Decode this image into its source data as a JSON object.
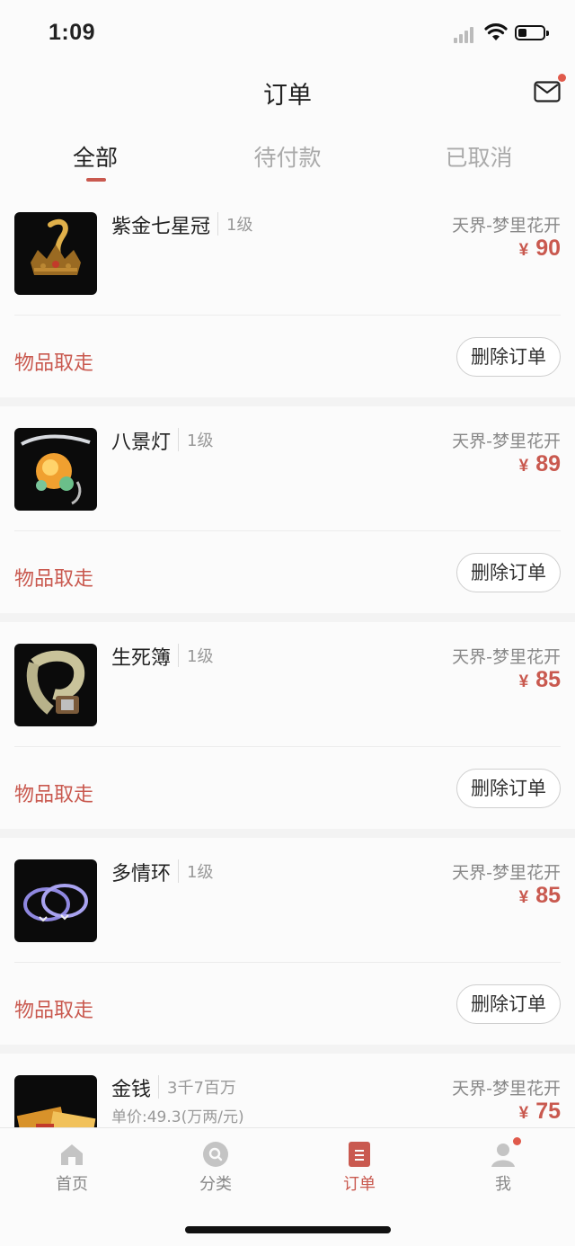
{
  "status_bar": {
    "time": "1:09"
  },
  "header": {
    "title": "订单"
  },
  "tabs": [
    {
      "label": "全部",
      "active": true
    },
    {
      "label": "待付款",
      "active": false
    },
    {
      "label": "已取消",
      "active": false
    }
  ],
  "orders": [
    {
      "name": "紫金七星冠",
      "level": "1级",
      "server": "天界-梦里花开",
      "currency": "¥",
      "price": "90",
      "status": "物品取走",
      "action": "删除订单",
      "icon": "crown-item-icon"
    },
    {
      "name": "八景灯",
      "level": "1级",
      "server": "天界-梦里花开",
      "currency": "¥",
      "price": "89",
      "status": "物品取走",
      "action": "删除订单",
      "icon": "lantern-item-icon"
    },
    {
      "name": "生死簿",
      "level": "1级",
      "server": "天界-梦里花开",
      "currency": "¥",
      "price": "85",
      "status": "物品取走",
      "action": "删除订单",
      "icon": "scroll-book-item-icon"
    },
    {
      "name": "多情环",
      "level": "1级",
      "server": "天界-梦里花开",
      "currency": "¥",
      "price": "85",
      "status": "物品取走",
      "action": "删除订单",
      "icon": "rings-item-icon"
    },
    {
      "name": "金钱",
      "level": "3千7百万",
      "unit_price": "单价:49.3(万两/元)",
      "server": "天界-梦里花开",
      "currency": "¥",
      "price": "75",
      "icon": "money-item-icon"
    }
  ],
  "bottom_nav": [
    {
      "label": "首页",
      "icon": "home-icon",
      "active": false
    },
    {
      "label": "分类",
      "icon": "search-category-icon",
      "active": false
    },
    {
      "label": "订单",
      "icon": "order-icon",
      "active": true
    },
    {
      "label": "我",
      "icon": "profile-icon",
      "active": false,
      "badge": true
    }
  ],
  "colors": {
    "accent": "#c9594f",
    "background": "#f3f3f3",
    "card": "#fbfbfb"
  }
}
